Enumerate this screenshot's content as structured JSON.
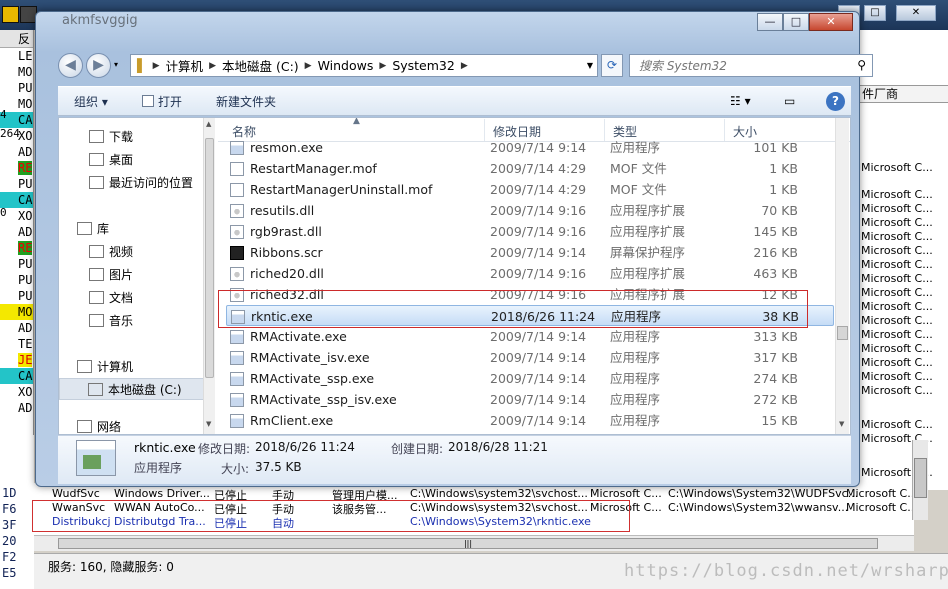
{
  "window": {
    "title": "akmfsvggig",
    "buttons": {
      "minimize": "—",
      "maximize": "□",
      "close": "✕"
    }
  },
  "address": {
    "segments": [
      "计算机",
      "本地磁盘 (C:)",
      "Windows",
      "System32"
    ],
    "search_placeholder": "搜索 System32"
  },
  "toolbar": {
    "organize": "组织 ▾",
    "open": "打开",
    "new_folder": "新建文件夹"
  },
  "nav_pane": {
    "items": [
      {
        "label": "下载",
        "icon": "download-folder-icon"
      },
      {
        "label": "桌面",
        "icon": "desktop-icon"
      },
      {
        "label": "最近访问的位置",
        "icon": "recent-places-icon"
      },
      {
        "label": "库",
        "icon": "library-icon"
      },
      {
        "label": "视频",
        "icon": "video-icon"
      },
      {
        "label": "图片",
        "icon": "pictures-icon"
      },
      {
        "label": "文档",
        "icon": "documents-icon"
      },
      {
        "label": "音乐",
        "icon": "music-icon"
      },
      {
        "label": "计算机",
        "icon": "computer-icon"
      },
      {
        "label": "本地磁盘 (C:)",
        "icon": "drive-icon"
      },
      {
        "label": "网络",
        "icon": "network-icon"
      }
    ]
  },
  "columns": {
    "name": "名称",
    "date": "修改日期",
    "type": "类型",
    "size": "大小"
  },
  "files": [
    {
      "name": "resmon.exe",
      "date": "2009/7/14 9:14",
      "type": "应用程序",
      "size": "101 KB",
      "icon": "exe"
    },
    {
      "name": "RestartManager.mof",
      "date": "2009/7/14 4:29",
      "type": "MOF 文件",
      "size": "1 KB",
      "icon": "mof"
    },
    {
      "name": "RestartManagerUninstall.mof",
      "date": "2009/7/14 4:29",
      "type": "MOF 文件",
      "size": "1 KB",
      "icon": "mof"
    },
    {
      "name": "resutils.dll",
      "date": "2009/7/14 9:16",
      "type": "应用程序扩展",
      "size": "70 KB",
      "icon": "dll"
    },
    {
      "name": "rgb9rast.dll",
      "date": "2009/7/14 9:16",
      "type": "应用程序扩展",
      "size": "145 KB",
      "icon": "dll"
    },
    {
      "name": "Ribbons.scr",
      "date": "2009/7/14 9:14",
      "type": "屏幕保护程序",
      "size": "216 KB",
      "icon": "scr"
    },
    {
      "name": "riched20.dll",
      "date": "2009/7/14 9:16",
      "type": "应用程序扩展",
      "size": "463 KB",
      "icon": "dll"
    },
    {
      "name": "riched32.dll",
      "date": "2009/7/14 9:16",
      "type": "应用程序扩展",
      "size": "12 KB",
      "icon": "dll"
    },
    {
      "name": "rkntic.exe",
      "date": "2018/6/26 11:24",
      "type": "应用程序",
      "size": "38 KB",
      "icon": "exe",
      "selected": true
    },
    {
      "name": "RMActivate.exe",
      "date": "2009/7/14 9:14",
      "type": "应用程序",
      "size": "313 KB",
      "icon": "exe"
    },
    {
      "name": "RMActivate_isv.exe",
      "date": "2009/7/14 9:14",
      "type": "应用程序",
      "size": "317 KB",
      "icon": "exe"
    },
    {
      "name": "RMActivate_ssp.exe",
      "date": "2009/7/14 9:14",
      "type": "应用程序",
      "size": "274 KB",
      "icon": "exe"
    },
    {
      "name": "RMActivate_ssp_isv.exe",
      "date": "2009/7/14 9:14",
      "type": "应用程序",
      "size": "272 KB",
      "icon": "exe"
    },
    {
      "name": "RmClient.exe",
      "date": "2009/7/14 9:14",
      "type": "应用程序",
      "size": "15 KB",
      "icon": "exe"
    }
  ],
  "details": {
    "name": "rkntic.exe",
    "type": "应用程序",
    "modified_label": "修改日期:",
    "modified_value": "2018/6/26 11:24",
    "created_label": "创建日期:",
    "created_value": "2018/6/28 11:21",
    "size_label": "大小:",
    "size_value": "37.5 KB"
  },
  "background": {
    "left_header": "反",
    "left_rows": [
      "LE",
      "MO",
      "PU",
      "MO",
      "CA",
      "XO",
      "AD",
      "RE",
      "PU",
      "CA",
      "XO",
      "AD",
      "RE",
      "PU",
      "PU",
      "PU",
      "MO",
      "AD",
      "TE",
      "JE",
      "CA",
      "XO",
      "AD"
    ],
    "left_numbers": [
      "4",
      "264",
      "0"
    ],
    "left_bottom_codes": [
      "1D",
      "F6",
      "3F",
      "20",
      "F2",
      "E5"
    ],
    "right_header": "件厂商",
    "right_cells": [
      "Microsoft C...",
      "Microsoft C...",
      "Microsoft C...",
      "Microsoft C...",
      "Microsoft C...",
      "Microsoft C...",
      "Microsoft C...",
      "Microsoft C...",
      "Microsoft C...",
      "Microsoft C...",
      "Microsoft C...",
      "Microsoft C...",
      "Microsoft C...",
      "Microsoft C...",
      "Microsoft C...",
      "Microsoft C...",
      "Microsoft C...",
      "Microsoft C...",
      "Microsoft C..."
    ],
    "services": [
      {
        "name": "WudfSvc",
        "display": "Windows Driver...",
        "status": "已停止",
        "startup": "手动",
        "desc": "管理用户模...",
        "path": "C:\\Windows\\system32\\svchost...",
        "company": "Microsoft C...",
        "image": "C:\\Windows\\System32\\WUDFSvc...",
        "vendor": "Microsoft C..."
      },
      {
        "name": "WwanSvc",
        "display": "WWAN AutoCo...",
        "status": "已停止",
        "startup": "手动",
        "desc": "该服务管...",
        "path": "C:\\Windows\\system32\\svchost...",
        "company": "Microsoft C...",
        "image": "C:\\Windows\\System32\\wwansv...",
        "vendor": "Microsoft C..."
      },
      {
        "name": "Distribukcj",
        "display": "Distributgd Tra...",
        "status": "已停止",
        "startup": "自动",
        "desc": "",
        "path": "C:\\Windows\\System32\\rkntic.exe",
        "company": "",
        "image": "",
        "vendor": ""
      }
    ],
    "status_bar": "服务:  160,  隐藏服务:  0",
    "watermark": "https://blog.csdn.net/wrsharper"
  }
}
